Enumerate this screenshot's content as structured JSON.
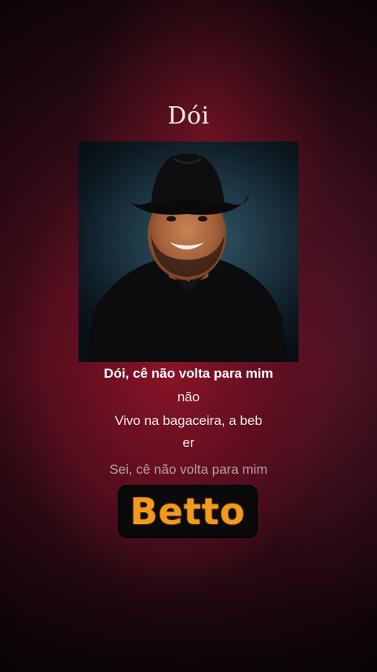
{
  "song": {
    "title": "Dói"
  },
  "cover": {
    "icon": "album-cover-artist-portrait"
  },
  "lyrics": {
    "active_line": "Dói, cê não volta para mim",
    "line_2": "não",
    "line_3": "Vivo na bagaceira, a beb",
    "line_4": "er",
    "next_line": "Sei, cê não volta para mim"
  },
  "brand": {
    "name": "Betto",
    "color": "#f39a1e"
  }
}
